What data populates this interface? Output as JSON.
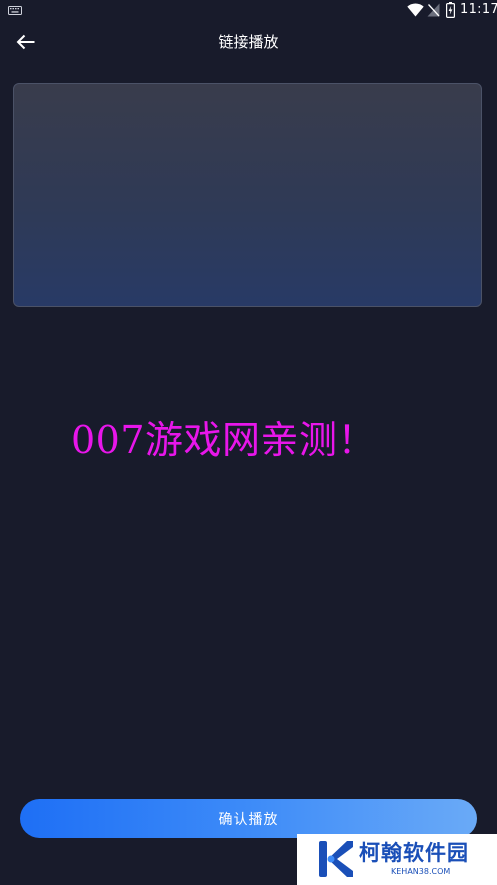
{
  "status_bar": {
    "time": "11:17",
    "icons": [
      "keyboard-icon",
      "wifi-icon",
      "no-signal-icon",
      "battery-charging-icon"
    ]
  },
  "header": {
    "back_icon": "arrow-left-icon",
    "title": "链接播放"
  },
  "link_input": {
    "value": "",
    "placeholder": ""
  },
  "watermark": {
    "text": "007游戏网亲测！",
    "color": "#e816ea"
  },
  "confirm_button": {
    "label": "确认播放"
  },
  "corner_logo": {
    "name": "柯翰软件园",
    "domain": "KEHAN38.COM"
  },
  "colors": {
    "background": "#181b2b",
    "button_start": "#1e6ff5",
    "button_end": "#6aaaf7",
    "logo_blue": "#1a4fb8"
  }
}
